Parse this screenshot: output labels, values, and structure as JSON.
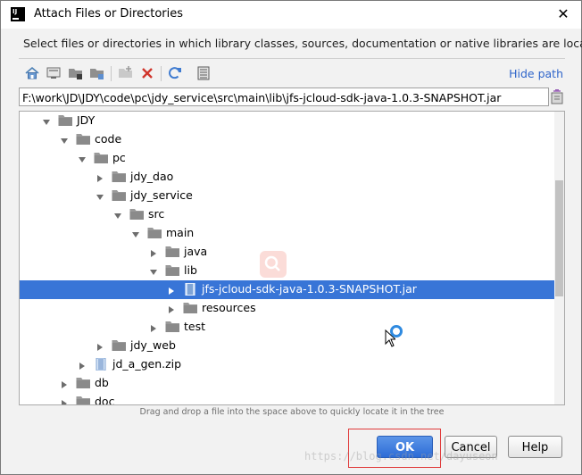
{
  "window": {
    "title": "Attach Files or Directories",
    "close_glyph": "✕",
    "app_icon": "intellij-idea-icon",
    "app_icon_text": "IJ"
  },
  "description": "Select files or directories in which library classes, sources, documentation or native libraries are located",
  "toolbar": {
    "items": [
      "home-icon",
      "desktop-icon",
      "project-icon",
      "module-icon",
      "new-folder-icon",
      "delete-icon",
      "refresh-icon",
      "show-hidden-icon"
    ],
    "hide_path_label": "Hide path"
  },
  "path_field": {
    "value": "F:\\work\\JD\\JDY\\code\\pc\\jdy_service\\src\\main\\lib\\jfs-jcloud-sdk-java-1.0.3-SNAPSHOT.jar"
  },
  "tree": {
    "nodes": [
      {
        "label": "JDY",
        "expanded": true,
        "type": "folder"
      },
      {
        "label": "code",
        "expanded": true,
        "type": "folder"
      },
      {
        "label": "pc",
        "expanded": true,
        "type": "folder"
      },
      {
        "label": "jdy_dao",
        "expanded": false,
        "type": "folder"
      },
      {
        "label": "jdy_service",
        "expanded": true,
        "type": "folder"
      },
      {
        "label": "src",
        "expanded": true,
        "type": "folder"
      },
      {
        "label": "main",
        "expanded": true,
        "type": "folder"
      },
      {
        "label": "java",
        "expanded": false,
        "type": "folder"
      },
      {
        "label": "lib",
        "expanded": true,
        "type": "folder"
      },
      {
        "label": "jfs-jcloud-sdk-java-1.0.3-SNAPSHOT.jar",
        "expanded": false,
        "type": "jar",
        "selected": true
      },
      {
        "label": "resources",
        "expanded": false,
        "type": "folder"
      },
      {
        "label": "test",
        "expanded": false,
        "type": "folder"
      },
      {
        "label": "jdy_web",
        "expanded": false,
        "type": "folder"
      },
      {
        "label": "jd_a_gen.zip",
        "expanded": false,
        "type": "zip"
      },
      {
        "label": "db",
        "expanded": false,
        "type": "folder"
      },
      {
        "label": "doc",
        "expanded": false,
        "type": "folder"
      }
    ]
  },
  "hint": "Drag and drop a file into the space above to quickly locate it in the tree",
  "buttons": {
    "ok": "OK",
    "cancel": "Cancel",
    "help": "Help"
  },
  "watermark": "https://blog.csdn.net/dayuseon",
  "colors": {
    "selection": "#3875d7",
    "link": "#2f65ca",
    "ok_button": "#2d6cd6",
    "highlight_box": "#e03a3a"
  }
}
